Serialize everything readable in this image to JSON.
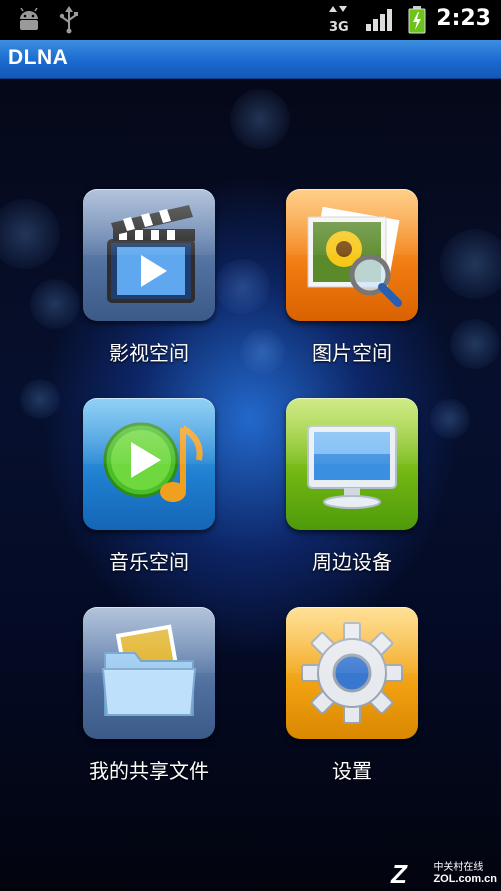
{
  "status_bar": {
    "time": "2:23",
    "network": "3G",
    "icons": [
      "android-debug-icon",
      "usb-icon",
      "network-3g-icon",
      "signal-icon",
      "battery-charging-icon"
    ]
  },
  "app_bar": {
    "title": "DLNA"
  },
  "grid": {
    "items": [
      {
        "label": "影视空间",
        "icon": "video-clapper-icon",
        "color": "#4f6f9e"
      },
      {
        "label": "图片空间",
        "icon": "photo-magnifier-icon",
        "color": "#f07a10"
      },
      {
        "label": "音乐空间",
        "icon": "music-play-icon",
        "color": "#1f7fd0"
      },
      {
        "label": "周边设备",
        "icon": "monitor-icon",
        "color": "#6fb512"
      },
      {
        "label": "我的共享文件",
        "icon": "shared-folder-icon",
        "color": "#4f6f9e"
      },
      {
        "label": "设置",
        "icon": "gear-icon",
        "color": "#f0a010"
      }
    ]
  },
  "watermark": {
    "brand": "中关村在线",
    "site": "ZOL.com.cn"
  }
}
